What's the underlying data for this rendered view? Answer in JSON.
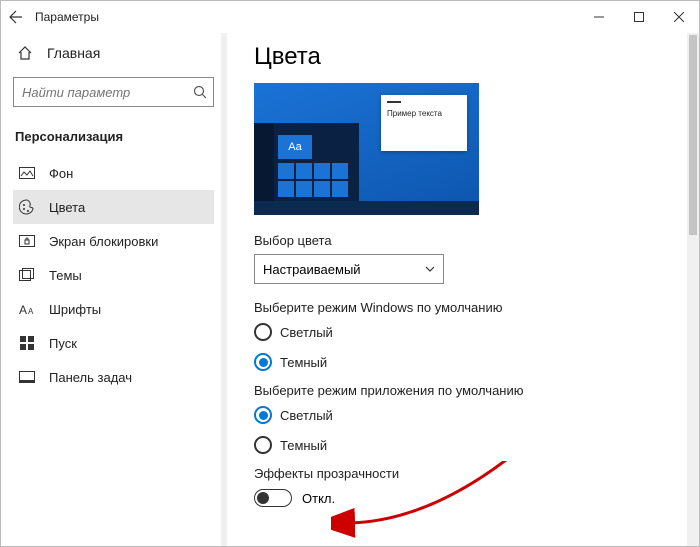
{
  "titlebar": {
    "back_alt": "back",
    "title": "Параметры"
  },
  "sidebar": {
    "home": "Главная",
    "search_placeholder": "Найти параметр",
    "section": "Персонализация",
    "items": [
      {
        "label": "Фон"
      },
      {
        "label": "Цвета"
      },
      {
        "label": "Экран блокировки"
      },
      {
        "label": "Темы"
      },
      {
        "label": "Шрифты"
      },
      {
        "label": "Пуск"
      },
      {
        "label": "Панель задач"
      }
    ]
  },
  "main": {
    "heading": "Цвета",
    "preview_sample_text": "Пример текста",
    "preview_tile_aa": "Aa",
    "color_choice_label": "Выбор цвета",
    "color_choice_value": "Настраиваемый",
    "windows_mode_label": "Выберите режим Windows по умолчанию",
    "windows_mode_options": {
      "light": "Светлый",
      "dark": "Темный"
    },
    "app_mode_label": "Выберите режим приложения по умолчанию",
    "app_mode_options": {
      "light": "Светлый",
      "dark": "Темный"
    },
    "transparency_label": "Эффекты прозрачности",
    "transparency_state": "Откл."
  }
}
